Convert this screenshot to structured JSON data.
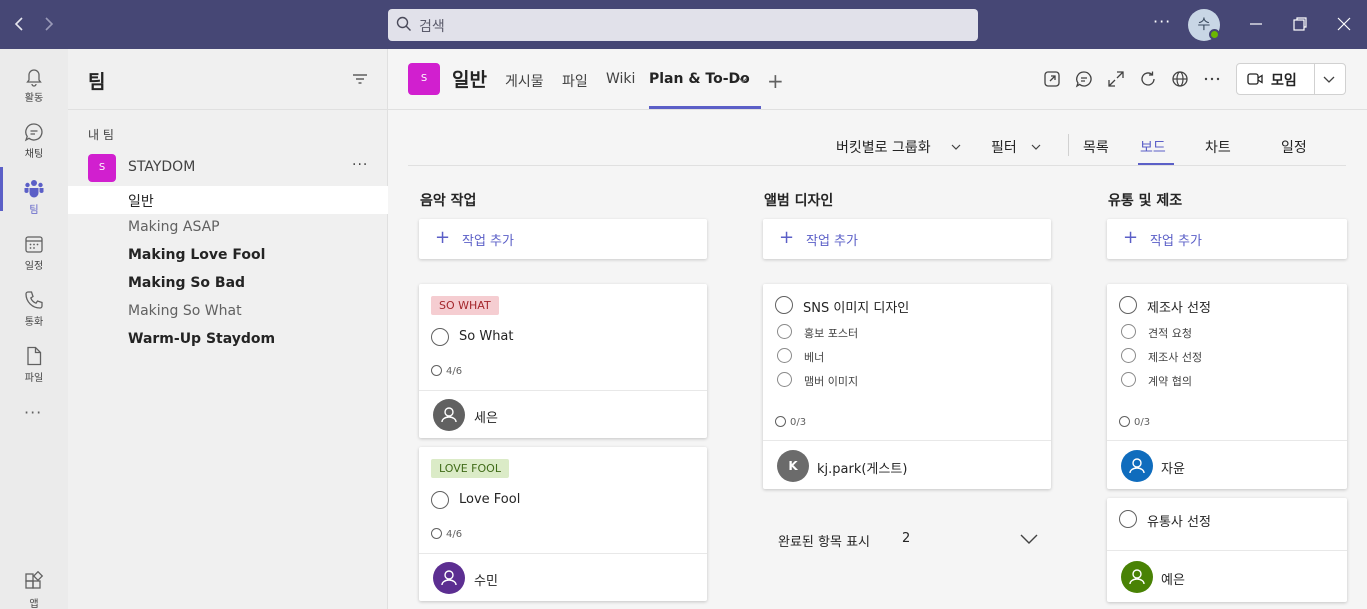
{
  "search": {
    "placeholder": "검색"
  },
  "titlebar": {
    "user_initial": "수",
    "more": "···"
  },
  "rail": {
    "items": [
      {
        "label": "활동",
        "icon": "bell-icon"
      },
      {
        "label": "채팅",
        "icon": "chat-icon"
      },
      {
        "label": "팀",
        "icon": "teams-icon"
      },
      {
        "label": "일정",
        "icon": "calendar-icon"
      },
      {
        "label": "통화",
        "icon": "phone-icon"
      },
      {
        "label": "파일",
        "icon": "file-icon"
      }
    ],
    "more": "···",
    "apps_label": "앱"
  },
  "panel": {
    "title": "팀",
    "section": "내 팀",
    "team": {
      "initial": "S",
      "name": "STAYDOM",
      "more": "···"
    },
    "channels": [
      {
        "name": "일반"
      },
      {
        "name": "Making ASAP"
      },
      {
        "name": "Making Love Fool"
      },
      {
        "name": "Making So Bad"
      },
      {
        "name": "Making So What"
      },
      {
        "name": "Warm-Up Staydom"
      }
    ]
  },
  "header": {
    "channel_initial": "S",
    "channel_name": "일반",
    "tabs": [
      "게시물",
      "파일",
      "Wiki",
      "Plan & To-Do"
    ],
    "plus": "+",
    "meet_label": "모임"
  },
  "toolbar": {
    "group_by": "버킷별로 그룹화",
    "filter": "필터",
    "views": [
      "목록",
      "보드",
      "차트",
      "일정"
    ]
  },
  "board": {
    "add_task_label": "작업 추가",
    "buckets": [
      {
        "title": "음악 작업",
        "cards": [
          {
            "label": "SO WHAT",
            "label_bg": "#f5cdd1",
            "label_fg": "#a4262c",
            "title": "So What",
            "progress": "4/6",
            "assignee": "세은",
            "avatar_color": "#616161"
          },
          {
            "label": "LOVE FOOL",
            "label_bg": "#dbebc7",
            "label_fg": "#3f6b17",
            "title": "Love Fool",
            "progress": "4/6",
            "assignee": "수민",
            "avatar_color": "#5c2e91"
          }
        ]
      },
      {
        "title": "앨범 디자인",
        "cards": [
          {
            "title": "SNS 이미지 디자인",
            "subtasks": [
              "홍보 포스터",
              "베너",
              "맴버 이미지"
            ],
            "progress": "0/3",
            "assignee": "kj.park(게스트)",
            "avatar_initial": "K",
            "avatar_color": "#6b6b6b"
          }
        ],
        "completed_label": "완료된 항목 표시",
        "completed_count": "2"
      },
      {
        "title": "유통 및 제조",
        "cards": [
          {
            "title": "제조사 선정",
            "subtasks": [
              "견적 요청",
              "제조사 선정",
              "계약 협의"
            ],
            "progress": "0/3",
            "assignee": "자윤",
            "avatar_color": "#0f6cbd"
          },
          {
            "title": "유통사 선정",
            "assignee": "예은",
            "avatar_color": "#498205"
          }
        ]
      }
    ]
  }
}
